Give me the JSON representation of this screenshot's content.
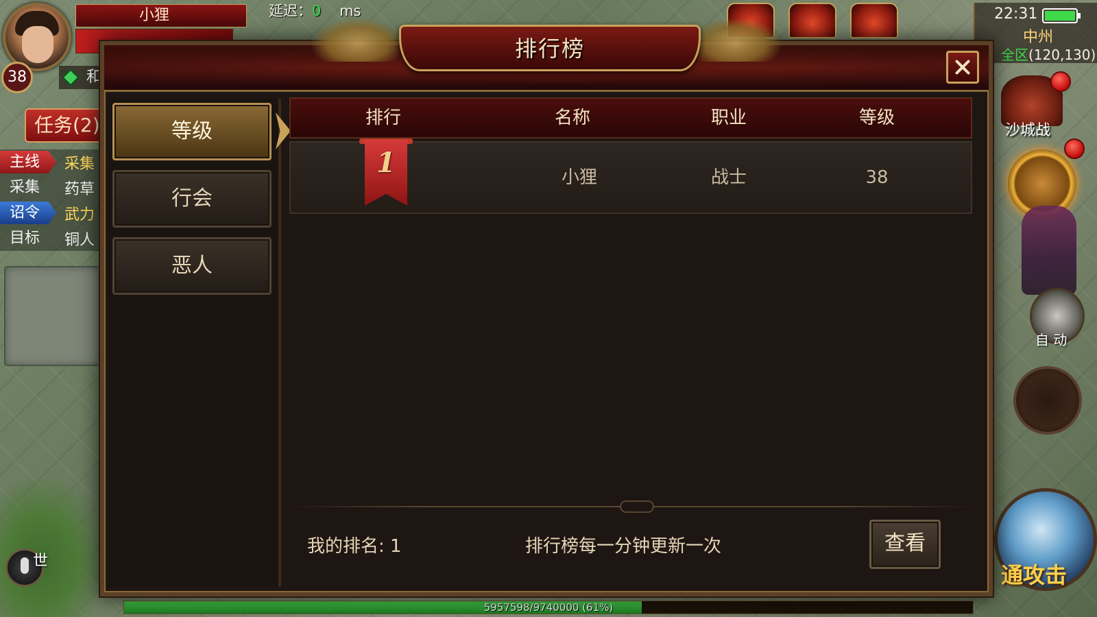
{
  "hud": {
    "player_name": "小狸",
    "player_level": "38",
    "latency_label": "延迟：",
    "latency_value": "0",
    "latency_unit": "ms",
    "status_text": "和",
    "clock": "22:31",
    "map_name": "中州",
    "zone": "全区",
    "coordinates": "(120,130)",
    "castle_war": "沙城战",
    "auto_label": "自 动",
    "attack_label": "通攻击",
    "channel_label": "世",
    "exp_text": "5957598/9740000 (61%)",
    "exp_fraction": 0.61
  },
  "quests": {
    "button_label": "任务(2)",
    "items": [
      {
        "tag": "主线",
        "desc": "采集",
        "tag_style": "red",
        "desc_style": "yellow"
      },
      {
        "tag": "采集",
        "desc": "药草",
        "tag_style": "plain",
        "desc_style": "white"
      },
      {
        "tag": "诏令",
        "desc": "武力",
        "tag_style": "blue",
        "desc_style": "yellow"
      },
      {
        "tag": "目标",
        "desc": "铜人",
        "tag_style": "plain",
        "desc_style": "white"
      }
    ]
  },
  "dialog": {
    "title": "排行榜",
    "categories": [
      {
        "label": "等级",
        "active": true
      },
      {
        "label": "行会",
        "active": false
      },
      {
        "label": "恶人",
        "active": false
      }
    ],
    "columns": [
      "排行",
      "名称",
      "职业",
      "等级"
    ],
    "rows": [
      {
        "rank": "1",
        "name": "小狸",
        "class": "战士",
        "level": "38"
      }
    ],
    "my_rank_label": "我的排名: 1",
    "update_note": "排行榜每一分钟更新一次",
    "view_button": "查看"
  },
  "colors": {
    "accent_gold": "#c9a35b",
    "header_red": "#4a0e0c",
    "latency_green": "#36e04a"
  }
}
